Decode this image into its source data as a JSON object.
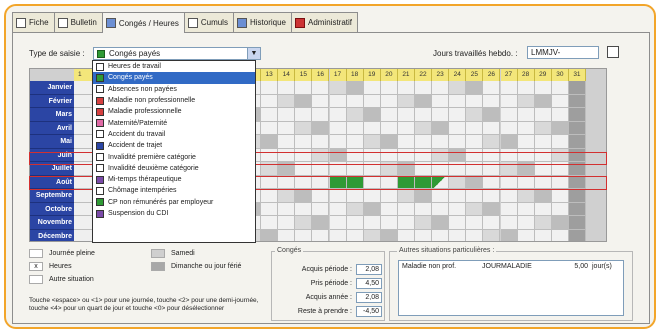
{
  "tabs": [
    {
      "label": "Fiche",
      "icon": "card-icon"
    },
    {
      "label": "Bulletin",
      "icon": "document-icon"
    },
    {
      "label": "Congés / Heures",
      "icon": "calendar-icon"
    },
    {
      "label": "Cumuls",
      "icon": "sum-icon"
    },
    {
      "label": "Historique",
      "icon": "history-icon"
    },
    {
      "label": "Administratif",
      "icon": "folder-icon"
    }
  ],
  "form": {
    "type_label": "Type de saisie :",
    "type_value": "Congés payés",
    "jours_label": "Jours travaillés hebdo. :",
    "jours_value": "LMMJV-"
  },
  "grid": {
    "first_day_label": "1",
    "months": [
      "Janvier",
      "Février",
      "Mars",
      "Avril",
      "Mai",
      "Juin",
      "Juillet",
      "Août",
      "Septembre",
      "Octobre",
      "Novembre",
      "Décembre"
    ],
    "days": [
      "12",
      "13",
      "14",
      "15",
      "16",
      "17",
      "18",
      "19",
      "20",
      "21",
      "22",
      "23",
      "24",
      "25",
      "26",
      "27",
      "28",
      "29",
      "30",
      "31"
    ],
    "green_cells_aout": [
      "17",
      "18",
      "21",
      "22"
    ],
    "half_cell_aout": "23"
  },
  "dropdown": {
    "options": [
      {
        "label": "Heures de travail",
        "color": "#ffffff"
      },
      {
        "label": "Congés payés",
        "color": "#2f9a35",
        "selected": true
      },
      {
        "label": "Absences non payées",
        "color": "#ffffff"
      },
      {
        "label": "Maladie non professionnelle",
        "color": "#d64040"
      },
      {
        "label": "Maladie professionnelle",
        "color": "#d64040"
      },
      {
        "label": "Maternité/Paternité",
        "color": "#e06aa6"
      },
      {
        "label": "Accident du travail",
        "color": "#ffffff"
      },
      {
        "label": "Accident de trajet",
        "color": "#2b45a4"
      },
      {
        "label": "Invalidité première catégorie",
        "color": "#ffffff"
      },
      {
        "label": "Invalidité deuxième catégorie",
        "color": "#ffffff"
      },
      {
        "label": "Mi-temps thérapeutique",
        "color": "#7a4aa8"
      },
      {
        "label": "Chômage intempéries",
        "color": "#ffffff"
      },
      {
        "label": "CP non rémunérés par employeur",
        "color": "#2f9a35"
      },
      {
        "label": "Suspension du CDI",
        "color": "#7a4aa8"
      }
    ]
  },
  "legend": {
    "journee_pleine": "Journée pleine",
    "heures": "Heures",
    "heures_mark": "x",
    "autre_situation": "Autre situation",
    "samedi": "Samedi",
    "dimanche": "Dimanche ou jour férié"
  },
  "help_text": "Touche <espace> ou <1> pour une journée, touche <2> pour une demi-journée, touche <4> pour un quart de jour et touche <0> pour désélectionner",
  "conges": {
    "title": "Congés",
    "rows": [
      {
        "label": "Acquis période :",
        "value": "2,08"
      },
      {
        "label": "Pris période :",
        "value": "4,50"
      },
      {
        "label": "Acquis année :",
        "value": "2,08"
      },
      {
        "label": "Reste à prendre :",
        "value": "-4,50"
      }
    ]
  },
  "autres": {
    "title": "Autres situations particulières :",
    "rows": [
      {
        "c1": "Maladie non prof.",
        "c2": "JOURMALADIE",
        "c3": "5,00",
        "c4": "jour(s)"
      }
    ]
  }
}
